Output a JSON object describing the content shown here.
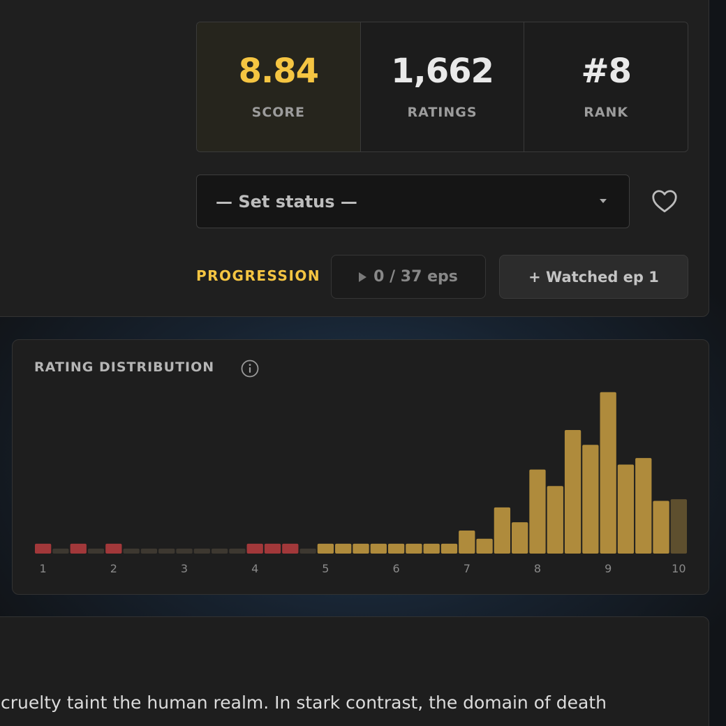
{
  "stats": [
    {
      "value": "8.84",
      "label": "SCORE"
    },
    {
      "value": "1,662",
      "label": "RATINGS"
    },
    {
      "value": "#8",
      "label": "RANK"
    }
  ],
  "status": {
    "placeholder": "— Set status —"
  },
  "progression": {
    "label": "PROGRESSION",
    "episodes": "0 / 37 eps",
    "watched_button": "+ Watched ep 1"
  },
  "distribution": {
    "title": "RATING DISTRIBUTION"
  },
  "description": {
    "text": "cruelty taint the human realm. In stark contrast, the domain of death"
  },
  "colors": {
    "accent": "#f5c542",
    "bar_high": "#af8b3c",
    "bar_low": "#a2383a",
    "bar_empty": "#3d3830"
  },
  "chart_data": {
    "type": "bar",
    "title": "RATING DISTRIBUTION",
    "xlabel": "",
    "ylabel": "",
    "tick_labels": [
      "1",
      "2",
      "3",
      "4",
      "5",
      "6",
      "7",
      "8",
      "9",
      "10"
    ],
    "x": [
      1.0,
      1.25,
      1.5,
      1.75,
      2.0,
      2.25,
      2.5,
      2.75,
      3.0,
      3.25,
      3.5,
      3.75,
      4.0,
      4.25,
      4.5,
      4.75,
      5.0,
      5.25,
      5.5,
      5.75,
      6.0,
      6.25,
      6.5,
      6.75,
      7.0,
      7.25,
      7.5,
      7.75,
      8.0,
      8.25,
      8.5,
      8.75,
      9.0,
      9.25,
      9.5,
      9.75,
      10.0
    ],
    "values": [
      6,
      3,
      6,
      3,
      6,
      3,
      3,
      3,
      3,
      3,
      3,
      3,
      6,
      6,
      6,
      3,
      6,
      6,
      6,
      6,
      6,
      6,
      6,
      6,
      14,
      9,
      28,
      19,
      51,
      41,
      75,
      66,
      98,
      54,
      58,
      32,
      33
    ],
    "colors": [
      "low",
      "empty",
      "low",
      "empty",
      "low",
      "empty",
      "empty",
      "empty",
      "empty",
      "empty",
      "empty",
      "empty",
      "low",
      "low",
      "low",
      "empty",
      "high",
      "high",
      "high",
      "high",
      "high",
      "high",
      "high",
      "high",
      "high",
      "high",
      "high",
      "high",
      "high",
      "high",
      "high",
      "high",
      "high",
      "high",
      "high",
      "high",
      "dim"
    ],
    "ylim": [
      0,
      100
    ],
    "grid": false
  }
}
